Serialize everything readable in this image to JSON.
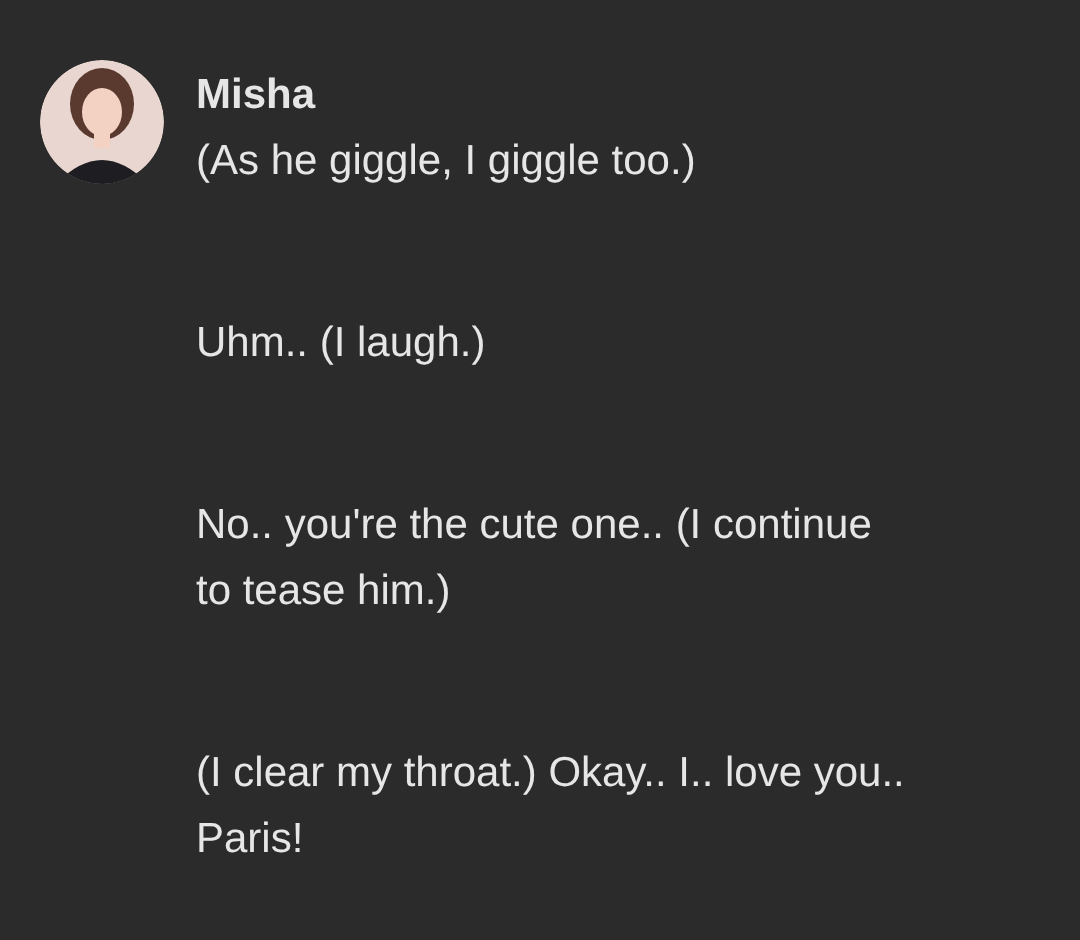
{
  "message": {
    "author": "Misha",
    "paragraphs": [
      "(As he giggle, I giggle too.)",
      "Uhm.. (I laugh.)",
      "No.. you're the cute one.. (I continue to tease him.)",
      "(I clear my throat.) Okay.. I.. love you.. Paris!"
    ]
  }
}
